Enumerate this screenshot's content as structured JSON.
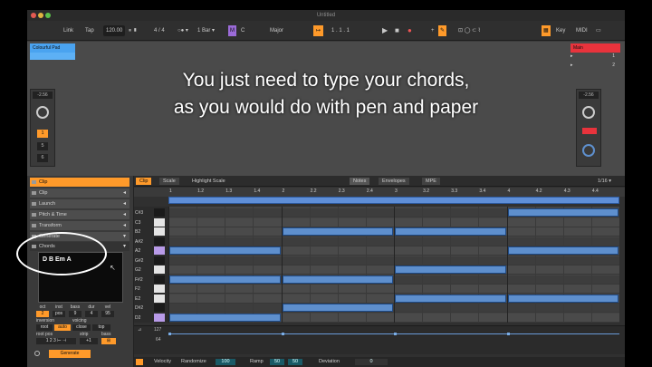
{
  "window": {
    "title": "Untitled"
  },
  "toolbar": {
    "link": "Link",
    "tap": "Tap",
    "tempo": "120.00",
    "meter": "4 / 4",
    "metronome": "○● ▾",
    "quant": "1 Bar ▾",
    "key_badge": "M",
    "key_root": "C",
    "scale": "Major",
    "position": "1 . 1 . 1",
    "key_label": "Key",
    "midi_label": "MIDI"
  },
  "tracks": {
    "left_name": "Colourful Pad",
    "right_name": "Main",
    "left_volume": "-2.56",
    "right_volume": "-2.56",
    "track_number": "1",
    "sends": [
      "1",
      "5",
      "6"
    ],
    "master_numbers": [
      "1",
      "2"
    ]
  },
  "overlay": {
    "line1": "You just need to type your chords,",
    "line2": "as you would do with pen and paper"
  },
  "left_panel": {
    "rows": [
      {
        "label": "Clip",
        "highlight": true
      },
      {
        "label": "Clip",
        "highlight": false
      },
      {
        "label": "Launch",
        "highlight": false
      },
      {
        "label": "Pitch & Time",
        "highlight": false
      },
      {
        "label": "Transform",
        "highlight": false
      },
      {
        "label": "Generate",
        "highlight": false
      },
      {
        "label": "Chords",
        "highlight": false
      }
    ],
    "chord_text": "D B Em A",
    "param_labels": [
      "oct",
      "inst",
      "bass",
      "dur",
      "vel"
    ],
    "param_values": [
      "2",
      "pos",
      "9",
      "4",
      "95"
    ],
    "inversion_label": "inversion",
    "voicing_label": "voicing",
    "inversion_opts": [
      "root",
      "auto",
      "close",
      "top"
    ],
    "rootpos_label": "root pos",
    "strip_label": "strip",
    "bass_label": "bass",
    "generate": "Generate"
  },
  "piano_roll": {
    "tabs": [
      "Clip",
      "Scale",
      "Highlight Scale"
    ],
    "right_tabs": [
      "Notes",
      "Envelopes",
      "MPE"
    ],
    "fraction": "1/16 ▾",
    "ruler": [
      "1",
      "1.2",
      "1.3",
      "1.4",
      "2",
      "2.2",
      "2.3",
      "2.4",
      "3",
      "3.2",
      "3.3",
      "3.4",
      "4",
      "4.2",
      "4.3",
      "4.4"
    ],
    "keys": [
      "C#3",
      "C3",
      "B2",
      "A#2",
      "A2",
      "G#2",
      "G2",
      "F#2",
      "F2",
      "E2",
      "D#2",
      "D2"
    ],
    "notes": [
      {
        "pitch": "C#3",
        "start": 4,
        "end": 5
      },
      {
        "pitch": "B2",
        "start": 2,
        "end": 3
      },
      {
        "pitch": "B2",
        "start": 3,
        "end": 4
      },
      {
        "pitch": "A2",
        "start": 1,
        "end": 2
      },
      {
        "pitch": "A2",
        "start": 4,
        "end": 5
      },
      {
        "pitch": "G2",
        "start": 3,
        "end": 4
      },
      {
        "pitch": "F#2",
        "start": 1,
        "end": 2
      },
      {
        "pitch": "F#2",
        "start": 2,
        "end": 3
      },
      {
        "pitch": "E2",
        "start": 3,
        "end": 4
      },
      {
        "pitch": "E2",
        "start": 4,
        "end": 5
      },
      {
        "pitch": "D#2",
        "start": 2,
        "end": 3
      },
      {
        "pitch": "D2",
        "start": 1,
        "end": 2
      }
    ],
    "velocity_top": "127",
    "velocity_mid": "64",
    "bottom": {
      "velocity_label": "Velocity",
      "randomize_label": "Randomize",
      "randomize_val": "100",
      "ramp_label": "Ramp",
      "ramp_a": "50",
      "ramp_b": "50",
      "deviation_label": "Deviation",
      "deviation_val": "0"
    }
  },
  "colors": {
    "accent": "#ff9a2a",
    "note": "#5e8fcd",
    "track_blue": "#4aa3f0",
    "master_red": "#e8333c"
  }
}
